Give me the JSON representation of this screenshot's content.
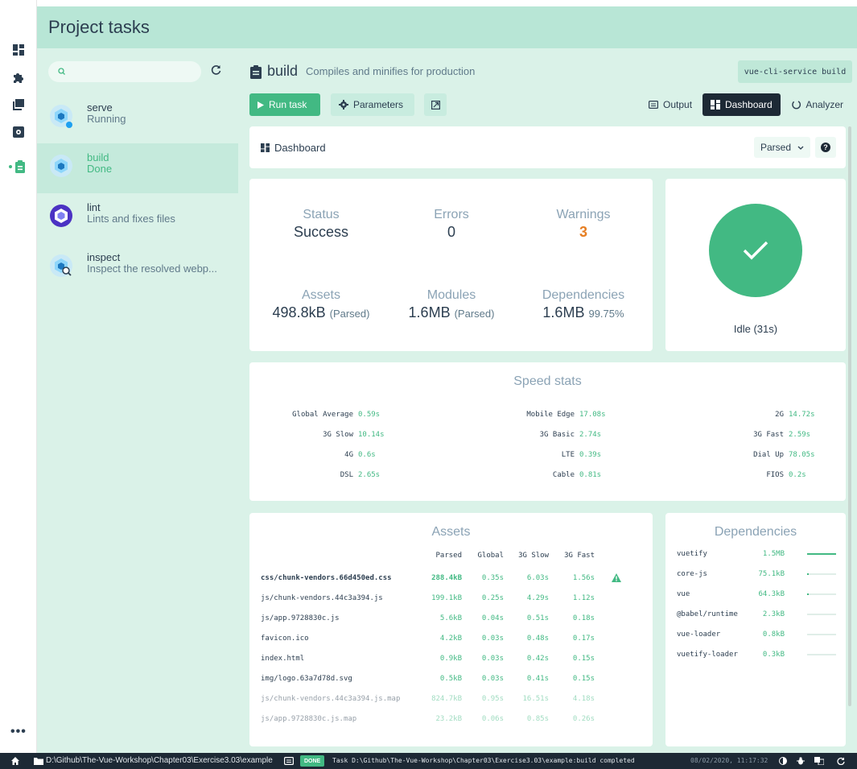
{
  "header": {
    "title": "Project tasks"
  },
  "rail": {
    "icons": [
      "dashboard-icon",
      "puzzle-icon",
      "dependencies-icon",
      "configuration-icon",
      "tasks-icon"
    ],
    "more": "•••"
  },
  "tasklist": {
    "search_placeholder": "",
    "tasks": [
      {
        "name": "serve",
        "desc": "Running",
        "icon": "webpack-icon",
        "selected": false,
        "status_dot": true
      },
      {
        "name": "build",
        "desc": "Done",
        "icon": "webpack-icon",
        "selected": true,
        "status_dot": false
      },
      {
        "name": "lint",
        "desc": "Lints and fixes files",
        "icon": "eslint-icon",
        "selected": false,
        "status_dot": false
      },
      {
        "name": "inspect",
        "desc": "Inspect the resolved webp...",
        "icon": "inspect-icon",
        "selected": false,
        "status_dot": false
      }
    ]
  },
  "task": {
    "name": "build",
    "description": "Compiles and minifies for production",
    "command": "vue-cli-service build"
  },
  "toolbar": {
    "run_label": "Run task",
    "parameters_label": "Parameters",
    "output_label": "Output",
    "dashboard_label": "Dashboard",
    "analyzer_label": "Analyzer"
  },
  "dashboard": {
    "title": "Dashboard",
    "mode_select": "Parsed",
    "stats": {
      "status_label": "Status",
      "status_value": "Success",
      "errors_label": "Errors",
      "errors_value": "0",
      "warnings_label": "Warnings",
      "warnings_value": "3",
      "assets_label": "Assets",
      "assets_value": "498.8kB",
      "assets_sub": "(Parsed)",
      "modules_label": "Modules",
      "modules_value": "1.6MB",
      "modules_sub": "(Parsed)",
      "deps_label": "Dependencies",
      "deps_value": "1.6MB",
      "deps_sub": "99.75%"
    },
    "idle_text": "Idle (31s)",
    "speed": {
      "title": "Speed stats",
      "items": [
        {
          "label": "Global Average",
          "value": "0.59s"
        },
        {
          "label": "Mobile Edge",
          "value": "17.08s"
        },
        {
          "label": "2G",
          "value": "14.72s"
        },
        {
          "label": "3G Slow",
          "value": "10.14s"
        },
        {
          "label": "3G Basic",
          "value": "2.74s"
        },
        {
          "label": "3G Fast",
          "value": "2.59s"
        },
        {
          "label": "4G",
          "value": "0.6s"
        },
        {
          "label": "LTE",
          "value": "0.39s"
        },
        {
          "label": "Dial Up",
          "value": "78.05s"
        },
        {
          "label": "DSL",
          "value": "2.65s"
        },
        {
          "label": "Cable",
          "value": "0.81s"
        },
        {
          "label": "FIOS",
          "value": "0.2s"
        }
      ]
    },
    "assets": {
      "title": "Assets",
      "columns": [
        "Parsed",
        "Global",
        "3G Slow",
        "3G Fast"
      ],
      "rows": [
        {
          "name": "css/chunk-vendors.66d450ed.css",
          "parsed": "288.4kB",
          "global": "0.35s",
          "slow": "6.03s",
          "fast": "1.56s",
          "warning": true,
          "bold": true,
          "faded": false
        },
        {
          "name": "js/chunk-vendors.44c3a394.js",
          "parsed": "199.1kB",
          "global": "0.25s",
          "slow": "4.29s",
          "fast": "1.12s",
          "warning": false,
          "bold": false,
          "faded": false
        },
        {
          "name": "js/app.9728830c.js",
          "parsed": "5.6kB",
          "global": "0.04s",
          "slow": "0.51s",
          "fast": "0.18s",
          "warning": false,
          "bold": false,
          "faded": false
        },
        {
          "name": "favicon.ico",
          "parsed": "4.2kB",
          "global": "0.03s",
          "slow": "0.48s",
          "fast": "0.17s",
          "warning": false,
          "bold": false,
          "faded": false
        },
        {
          "name": "index.html",
          "parsed": "0.9kB",
          "global": "0.03s",
          "slow": "0.42s",
          "fast": "0.15s",
          "warning": false,
          "bold": false,
          "faded": false
        },
        {
          "name": "img/logo.63a7d78d.svg",
          "parsed": "0.5kB",
          "global": "0.03s",
          "slow": "0.41s",
          "fast": "0.15s",
          "warning": false,
          "bold": false,
          "faded": false
        },
        {
          "name": "js/chunk-vendors.44c3a394.js.map",
          "parsed": "824.7kB",
          "global": "0.95s",
          "slow": "16.51s",
          "fast": "4.18s",
          "warning": false,
          "bold": false,
          "faded": true
        },
        {
          "name": "js/app.9728830c.js.map",
          "parsed": "23.2kB",
          "global": "0.06s",
          "slow": "0.85s",
          "fast": "0.26s",
          "warning": false,
          "bold": false,
          "faded": true
        }
      ]
    },
    "dependencies": {
      "title": "Dependencies",
      "rows": [
        {
          "name": "vuetify",
          "size": "1.5MB",
          "share": 1.0
        },
        {
          "name": "core-js",
          "size": "75.1kB",
          "share": 0.05
        },
        {
          "name": "vue",
          "size": "64.3kB",
          "share": 0.04
        },
        {
          "name": "@babel/runtime",
          "size": "2.3kB",
          "share": 0
        },
        {
          "name": "vue-loader",
          "size": "0.8kB",
          "share": 0
        },
        {
          "name": "vuetify-loader",
          "size": "0.3kB",
          "share": 0
        }
      ]
    }
  },
  "statusbar": {
    "path": "D:\\Github\\The-Vue-Workshop\\Chapter03\\Exercise3.03\\example",
    "badge": "DONE",
    "message": "Task D:\\Github\\The-Vue-Workshop\\Chapter03\\Exercise3.03\\example:build completed",
    "datetime": "08/02/2020, 11:17:32"
  },
  "colors": {
    "accent": "#42b983",
    "dark": "#1d2935",
    "header": "#b8e6d6",
    "panel": "#daf2e8",
    "warning": "#e67e22"
  }
}
